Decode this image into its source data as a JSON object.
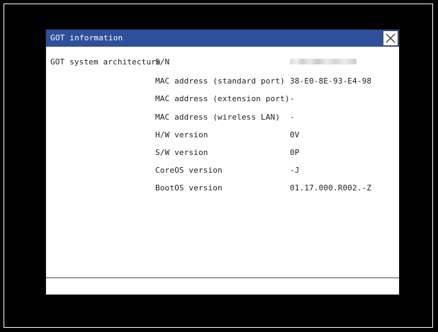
{
  "dialog": {
    "title": "GOT information",
    "section_label": "GOT system architecture",
    "rows": [
      {
        "label": "S/N",
        "value": ""
      },
      {
        "label": "MAC address (standard port)",
        "value": "38-E0-8E-93-E4-98"
      },
      {
        "label": "MAC address (extension port)",
        "value": "-"
      },
      {
        "label": "MAC address (wireless LAN)",
        "value": "-"
      },
      {
        "label": "H/W version",
        "value": "0V"
      },
      {
        "label": "S/W version",
        "value": "0P"
      },
      {
        "label": "CoreOS version",
        "value": "-J"
      },
      {
        "label": "BootOS version",
        "value": "01.17.000.R002.-Z"
      }
    ]
  },
  "colors": {
    "title_bar": "#2f4f9c",
    "window_background": "#ffffff",
    "screen_background": "#000000",
    "text": "#222222"
  },
  "icons": {
    "close": "close-icon"
  }
}
